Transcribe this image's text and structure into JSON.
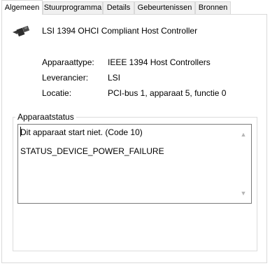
{
  "tabs": [
    {
      "label": "Algemeen",
      "active": true
    },
    {
      "label": "Stuurprogramma",
      "active": false
    },
    {
      "label": "Details",
      "active": false
    },
    {
      "label": "Gebeurtenissen",
      "active": false
    },
    {
      "label": "Bronnen",
      "active": false
    }
  ],
  "device": {
    "icon": "device-connector-icon",
    "name": "LSI 1394 OHCI Compliant Host Controller"
  },
  "properties": [
    {
      "label": "Apparaattype:",
      "value": "IEEE 1394 Host Controllers"
    },
    {
      "label": "Leverancier:",
      "value": "LSI"
    },
    {
      "label": "Locatie:",
      "value": "PCI-bus 1, apparaat 5, functie 0"
    }
  ],
  "status_group": {
    "title": "Apparaatstatus",
    "line1": "Dit apparaat start niet. (Code 10)",
    "line2": "STATUS_DEVICE_POWER_FAILURE"
  }
}
